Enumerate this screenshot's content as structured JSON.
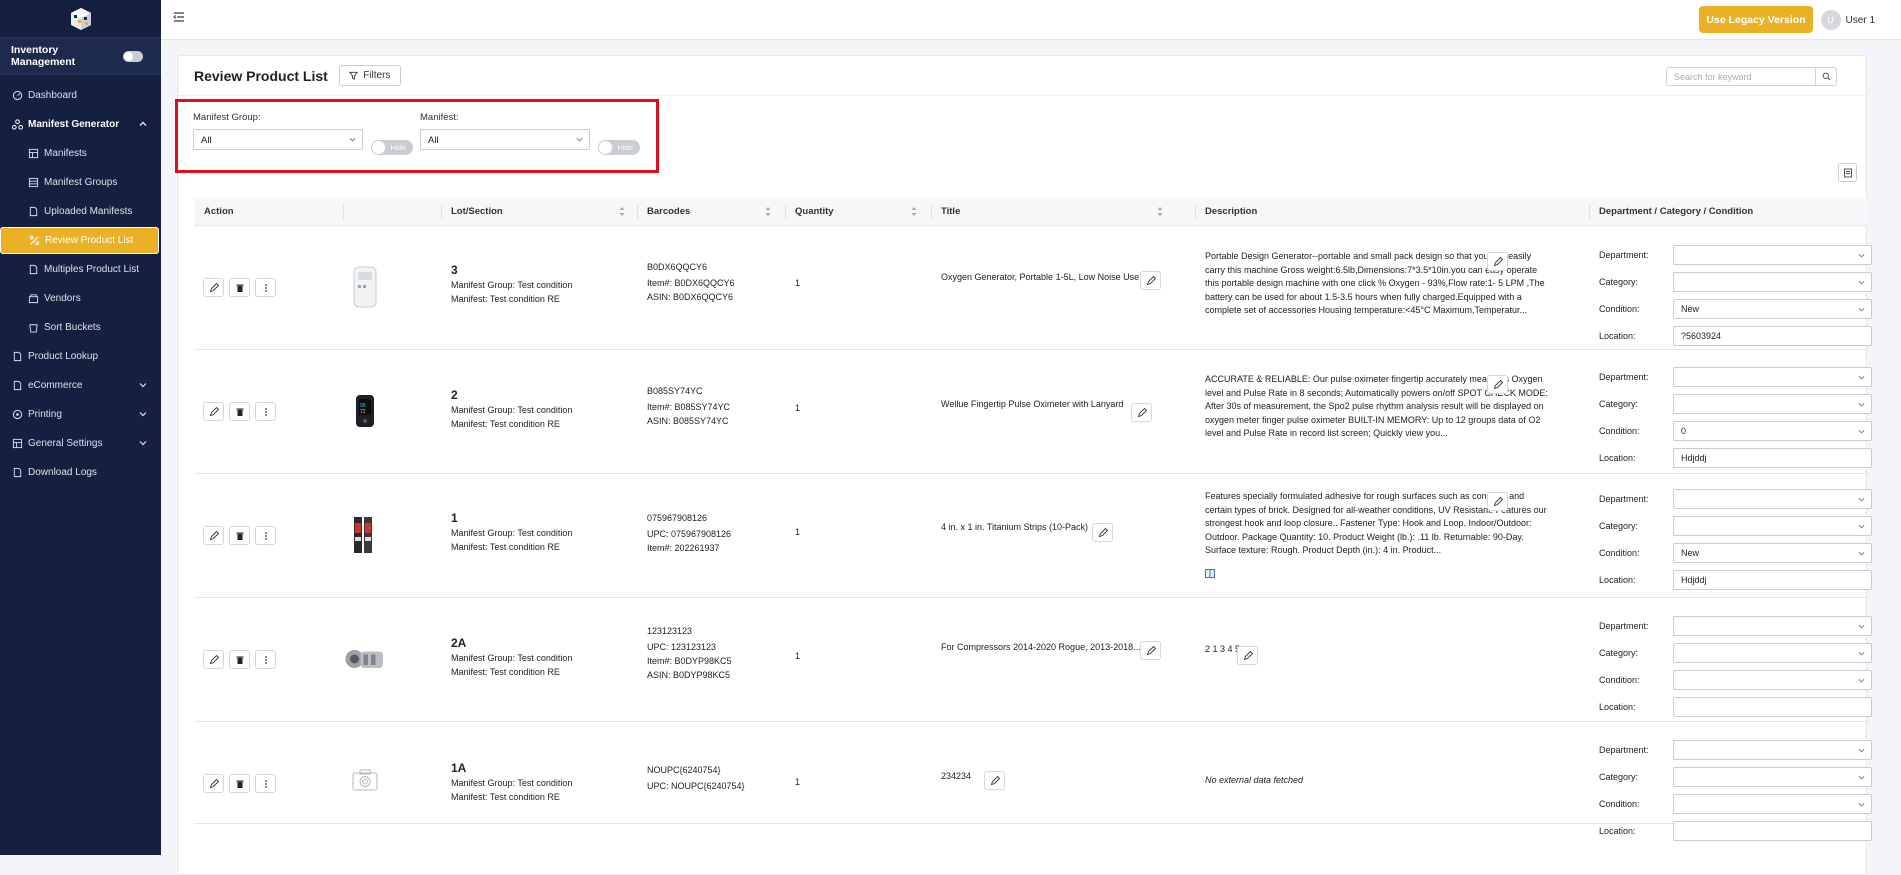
{
  "sidebar": {
    "logo_icon": "cube-logo-icon",
    "module_label": "Inventory Management",
    "items": [
      {
        "label": "Dashboard",
        "icon": "dashboard-icon"
      },
      {
        "label": "Manifest Generator",
        "icon": "manifest-generator-icon"
      },
      {
        "label": "Manifests",
        "icon": "manifests-icon"
      },
      {
        "label": "Manifest Groups",
        "icon": "manifest-groups-icon"
      },
      {
        "label": "Uploaded Manifests",
        "icon": "uploaded-manifests-icon"
      },
      {
        "label": "Review Product List",
        "icon": "review-icon"
      },
      {
        "label": "Multiples Product List",
        "icon": "multiples-icon"
      },
      {
        "label": "Vendors",
        "icon": "vendors-icon"
      },
      {
        "label": "Sort Buckets",
        "icon": "sort-buckets-icon"
      },
      {
        "label": "Product Lookup",
        "icon": "product-lookup-icon"
      },
      {
        "label": "eCommerce",
        "icon": "ecommerce-icon"
      },
      {
        "label": "Printing",
        "icon": "printing-icon"
      },
      {
        "label": "General Settings",
        "icon": "settings-icon"
      },
      {
        "label": "Download Logs",
        "icon": "download-logs-icon"
      }
    ]
  },
  "topbar": {
    "legacy_label": "Use Legacy Version",
    "user_initial": "U",
    "user_name": "User 1"
  },
  "page": {
    "title": "Review Product List",
    "filters_label": "Filters",
    "search_placeholder": "Search for keyword"
  },
  "filters": {
    "manifest_group_label": "Manifest Group:",
    "manifest_group_value": "All",
    "manifest_label": "Manifest:",
    "manifest_value": "All",
    "hide_label": "Hide"
  },
  "table": {
    "headers": {
      "action": "Action",
      "lot": "Lot/Section",
      "barcodes": "Barcodes",
      "quantity": "Quantity",
      "title": "Title",
      "description": "Description",
      "dcc": "Department / Category / Condition"
    },
    "field_labels": {
      "department": "Department:",
      "category": "Category:",
      "condition": "Condition:",
      "location": "Location:"
    },
    "rows": [
      {
        "lot": "3",
        "group": "Manifest Group: Test condition",
        "manifest": "Manifest: Test condition RE",
        "barcode_main": "B0DX6QQCY6",
        "barcode_line1": "Item#: B0DX6QQCY6",
        "barcode_line2": "ASIN: B0DX6QQCY6",
        "barcode_line3": "",
        "quantity": "1",
        "title": "Oxygen Generator, Portable 1-5L, Low Noise Use",
        "description": "Portable Design Generator--portable and small pack design so that you can easily carry this machine Gross weight:6.5lb,Dimensions:7*3.5*10in.you can easy operate this portable design machine with one click % Oxygen - 93%,Flow rate:1- 5 LPM ,The battery can be used for about 1.5-3.5 hours when fully charged.Equipped with a complete set of accessories Housing temperature:<45°C Maximum,Temperatur...",
        "department": "",
        "category": "",
        "condition": "New",
        "location": "?5603924"
      },
      {
        "lot": "2",
        "group": "Manifest Group: Test condition",
        "manifest": "Manifest: Test condition RE",
        "barcode_main": "B085SY74YC",
        "barcode_line1": "Item#: B085SY74YC",
        "barcode_line2": "ASIN: B085SY74YC",
        "barcode_line3": "",
        "quantity": "1",
        "title": "Wellue Fingertip Pulse Oximeter with Lanyard",
        "description": "ACCURATE & RELIABLE: Our pulse oximeter fingertip accurately measures Oxygen level and Pulse Rate in 8 seconds; Automatically powers on/off SPOT CHECK MODE: After 30s of measurement, the Spo2 pulse rhythm analysis result will be displayed on oxygen meter finger pulse oximeter BUILT-IN MEMORY: Up to 12 groups data of O2 level and Pulse Rate in record list screen; Quickly view you...",
        "department": "",
        "category": "",
        "condition": "0",
        "location": "Hdjddj"
      },
      {
        "lot": "1",
        "group": "Manifest Group: Test condition",
        "manifest": "Manifest: Test condition RE",
        "barcode_main": "075967908126",
        "barcode_line1": "UPC: 075967908126",
        "barcode_line2": "Item#: 202261937",
        "barcode_line3": "",
        "quantity": "1",
        "title": "4 in. x 1 in. Titanium Strips (10-Pack)",
        "description": "Features specially formulated adhesive for rough surfaces such as concrete and certain types of brick. Designed for all-weather conditions, UV Resistant. Features our strongest hook and loop closure.. Fastener Type: Hook and Loop. Indoor/Outdoor: Outdoor. Package Quantity: 10. Product Weight (lb.): .11 lb. Returnable: 90-Day. Surface texture: Rough. Product Depth (in.): 4 in. Product...",
        "department": "",
        "category": "",
        "condition": "New",
        "location": "Hdjddj"
      },
      {
        "lot": "2A",
        "group": "Manifest Group: Test condition",
        "manifest": "Manifest: Test condition RE",
        "barcode_main": "123123123",
        "barcode_line1": "UPC: 123123123",
        "barcode_line2": "Item#: B0DYP98KC5",
        "barcode_line3": "ASIN: B0DYP98KC5",
        "quantity": "1",
        "title": "For Compressors 2014-2020 Rogue, 2013-2018...",
        "description": "2 1 3 4 5",
        "department": "",
        "category": "",
        "condition": "",
        "location": ""
      },
      {
        "lot": "1A",
        "group": "Manifest Group: Test condition",
        "manifest": "Manifest: Test condition RE",
        "barcode_main": "NOUPC{6240754}",
        "barcode_line1": "UPC: NOUPC{6240754}",
        "barcode_line2": "",
        "barcode_line3": "",
        "quantity": "1",
        "title": "234234",
        "description": "No external data fetched",
        "department": "",
        "category": "",
        "condition": "",
        "location": ""
      }
    ]
  },
  "colors": {
    "sidebar_bg": "#152040",
    "accent": "#eab126",
    "highlight_border": "#dd0f1c"
  }
}
